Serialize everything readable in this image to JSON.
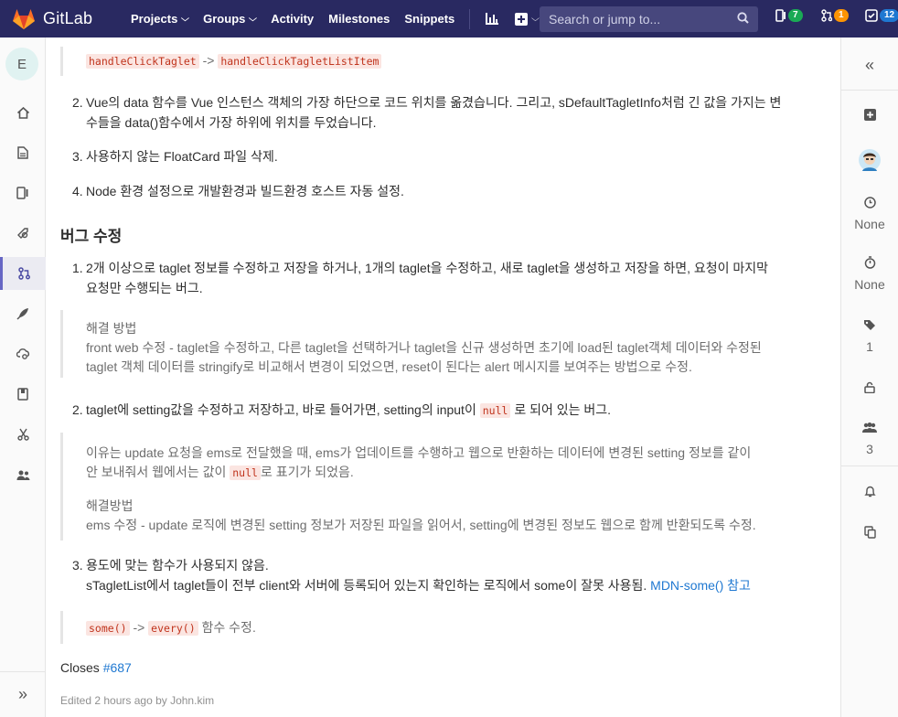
{
  "navbar": {
    "brand": "GitLab",
    "links": [
      "Projects",
      "Groups",
      "Activity",
      "Milestones",
      "Snippets"
    ],
    "search_placeholder": "Search or jump to...",
    "counters": {
      "issues": "7",
      "merge_requests": "1",
      "todos": "12"
    },
    "colors": {
      "bg": "#292961",
      "issues_badge": "#1aaa55",
      "mr_badge": "#fc9403",
      "todo_badge": "#1f78d1"
    }
  },
  "sidebar_left": {
    "project_initial": "E",
    "items": [
      "project-overview",
      "repository",
      "issues",
      "merge-requests",
      "ci-cd",
      "operations",
      "wiki",
      "snippets",
      "members"
    ]
  },
  "sidebar_right": {
    "collapse": "«",
    "milestone": "None",
    "time_tracking": "None",
    "labels_count": "1",
    "participants_count": "3"
  },
  "content": {
    "top_code_a": "handleClickTaglet",
    "top_arrow": "->",
    "top_code_b": "handleClickTagletListItem",
    "list1": [
      {
        "n": "2.",
        "line1": "Vue의 data 함수를 Vue 인스턴스 객체의 가장 하단으로 코드 위치를 옮겼습니다. 그리고, sDefaultTagletInfo처럼 긴 값을 가지는 변",
        "line2": "수들을 data()함수에서 가장 하위에 위치를 두었습니다."
      },
      {
        "n": "3.",
        "line1": "사용하지 않는 FloatCard 파일 삭제."
      },
      {
        "n": "4.",
        "line1": "Node 환경 설정으로 개발환경과 빌드환경 호스트 자동 설정."
      }
    ],
    "heading": "버그 수정",
    "bug1": {
      "n": "1.",
      "line1": "2개 이상으로 taglet 정보를 수정하고 저장을 하거나, 1개의 taglet을 수정하고, 새로 taglet을 생성하고 저장을 하면, 요청이 마지막",
      "line2": "요청만 수행되는 버그."
    },
    "bq1": {
      "title": "해결 방법",
      "line1": "front web 수정 - taglet을 수정하고, 다른 taglet을 선택하거나 taglet을 신규 생성하면 초기에 load된 taglet객체 데이터와 수정된",
      "line2": "taglet 객체 데이터를 stringify로 비교해서 변경이 되었으면, reset이 된다는 alert 메시지를 보여주는 방법으로 수정."
    },
    "bug2": {
      "n": "2.",
      "pre": "taglet에 setting값을 수정하고 저장하고, 바로 들어가면, setting의 input이",
      "code": "null",
      "post": "로 되어 있는 버그."
    },
    "bq2": {
      "line1": "이유는 update 요청을 ems로 전달했을 때, ems가 업데이트를 수행하고 웹으로 반환하는 데이터에 변경된 setting 정보를 같이",
      "line2_pre": "안 보내줘서 웹에서는 값이",
      "line2_code": "null",
      "line2_post": "로 표기가 되었음.",
      "title": "해결방법",
      "line3": "ems 수정 - update 로직에 변경된 setting 정보가 저장된 파일을 읽어서, setting에 변경된 정보도 웹으로 함께 반환되도록 수정."
    },
    "bug3": {
      "n": "3.",
      "line1": "용도에 맞는 함수가 사용되지 않음.",
      "line2": "sTagletList에서 taglet들이 전부 client와 서버에 등록되어 있는지 확인하는 로직에서 some이 잘못 사용됨.",
      "link": "MDN-some() 참고"
    },
    "bq3": {
      "code_a": "some()",
      "arrow": "->",
      "code_b": "every()",
      "post": "함수 수정."
    },
    "closes": "Closes",
    "closes_link": "#687",
    "edited": "Edited 2 hours ago by John.kim"
  }
}
